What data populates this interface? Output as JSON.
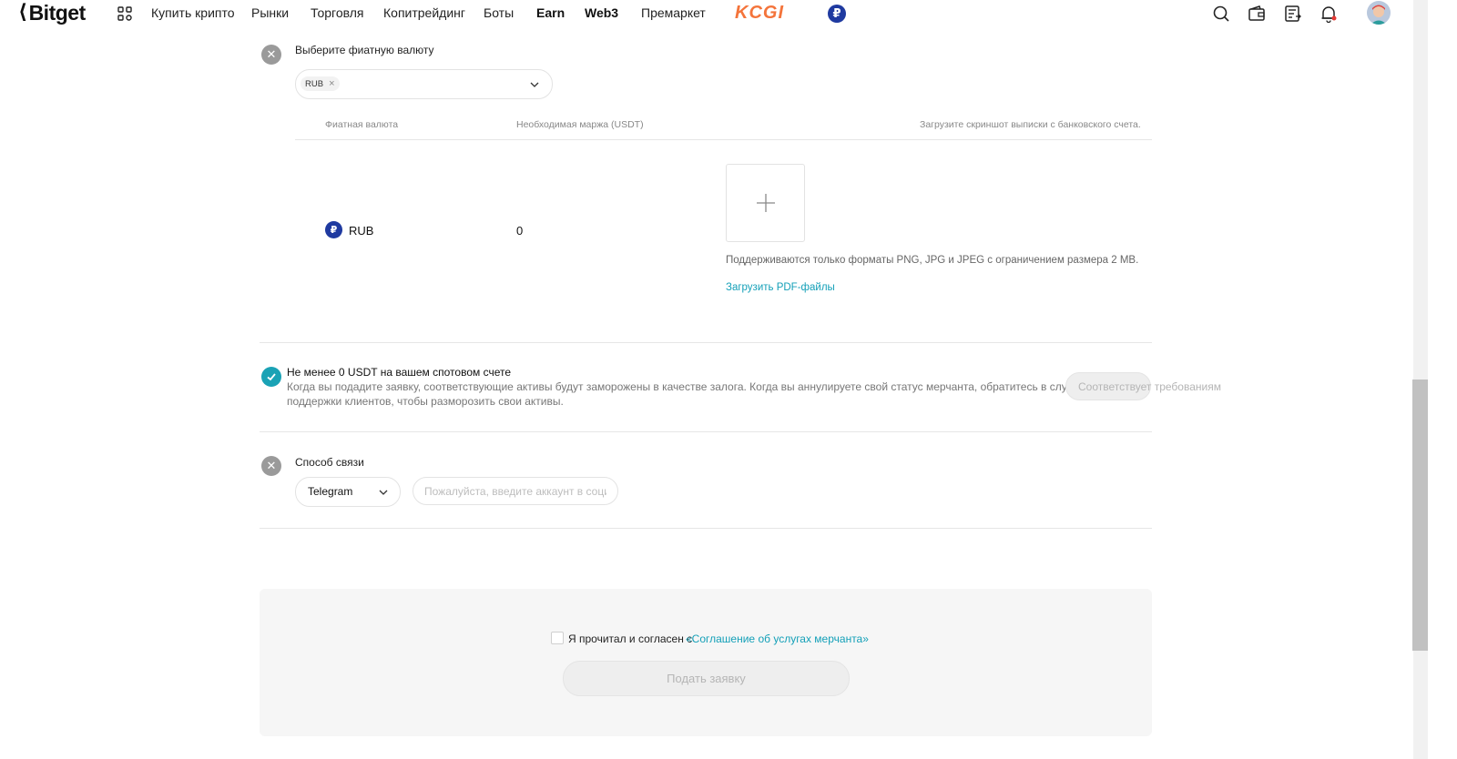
{
  "nav": {
    "logo": "Bitget",
    "items": [
      "Купить крипто",
      "Рынки",
      "Торговля",
      "Копитрейдинг",
      "Боты",
      "Earn",
      "Web3",
      "Премаркет"
    ],
    "promo": "KCGI",
    "currency_badge": "₽"
  },
  "fiat": {
    "title": "Выберите фиатную валюту",
    "selected_chip": "RUB",
    "chip_remove": "×",
    "table_headers": {
      "currency": "Фиатная валюта",
      "margin": "Необходимая маржа (USDT)",
      "upload": "Загрузите скриншот выписки с банковского счета."
    },
    "row": {
      "currency_icon": "₽",
      "currency": "RUB",
      "margin": "0"
    },
    "upload_hint": "Поддерживаются только форматы PNG, JPG и JPEG с ограничением размера 2 MB.",
    "upload_pdf_link": "Загрузить PDF-файлы"
  },
  "deposit": {
    "title": "Не менее 0 USDT на вашем спотовом счете",
    "desc_line1": "Когда вы подадите заявку, соответствующие активы будут заморожены в качестве залога. Когда вы аннулируете свой статус мерчанта, обратитесь в службу",
    "desc_line2": "поддержки клиентов, чтобы разморозить свои активы.",
    "status_button": "Соответствует требованиям"
  },
  "contact": {
    "title": "Способ связи",
    "method": "Telegram",
    "placeholder": "Пожалуйста, введите аккаунт в социальной сети"
  },
  "agreement": {
    "text": "Я прочитал и согласен с",
    "link": "«Соглашение об услугах мерчанта»",
    "submit": "Подать заявку"
  },
  "colors": {
    "accent": "#14a0b8",
    "success": "#1aa2b5",
    "error_icon": "#9a9a9a",
    "promo": "#f4743b",
    "rub": "#1f3aa0"
  }
}
